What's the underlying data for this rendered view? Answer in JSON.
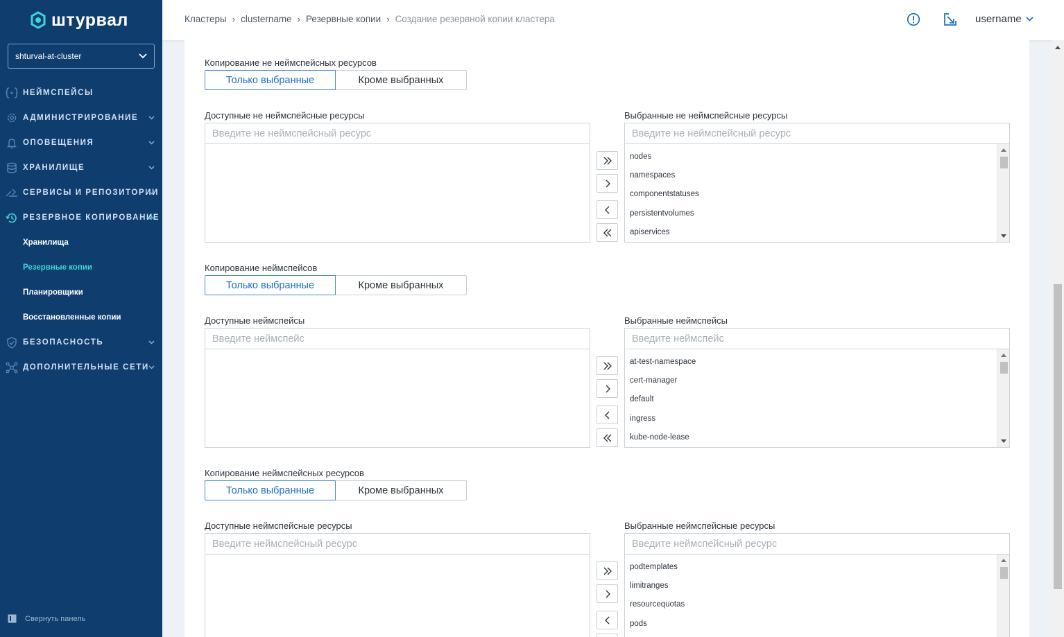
{
  "app": {
    "brand": "штурвал"
  },
  "sidebar": {
    "cluster": "shturval-at-cluster",
    "items": [
      {
        "label": "Неймспейсы",
        "icon": "braces-icon",
        "expandable": false
      },
      {
        "label": "Администрирование",
        "icon": "gear-icon",
        "expandable": true
      },
      {
        "label": "Оповещения",
        "icon": "bell-icon",
        "expandable": true
      },
      {
        "label": "Хранилище",
        "icon": "database-icon",
        "expandable": true
      },
      {
        "label": "Сервисы и репозитории",
        "icon": "services-icon",
        "expandable": true
      },
      {
        "label": "Резервное копирование",
        "icon": "backup-icon",
        "expandable": true,
        "expanded": true
      }
    ],
    "subitems": [
      {
        "label": "Хранилища",
        "active": false
      },
      {
        "label": "Резервные копии",
        "active": true
      },
      {
        "label": "Планировщики",
        "active": false
      },
      {
        "label": "Восстановленные копии",
        "active": false
      }
    ],
    "items_after": [
      {
        "label": "Безопасность",
        "icon": "shield-icon",
        "expandable": true
      },
      {
        "label": "Дополнительные сети",
        "icon": "network-icon",
        "expandable": true
      }
    ],
    "collapse_label": "Свернуть панель"
  },
  "header": {
    "breadcrumbs": [
      "Кластеры",
      "clustername",
      "Резервные копии",
      "Создание резервной копии кластера"
    ],
    "username": "username"
  },
  "colors": {
    "sidebar_bg": "#0f3d6e",
    "accent": "#1f6fc4",
    "active_sub": "#3fd4d8"
  },
  "sections": [
    {
      "title": "Копирование не неймспейсных ресурсов",
      "toggle": {
        "option_a": "Только выбранные",
        "option_b": "Кроме выбранных",
        "selected": "option_a"
      },
      "available": {
        "label": "Доступные не неймспейсные ресурсы",
        "placeholder": "Введите не неймспейсный ресурс",
        "items": []
      },
      "selected": {
        "label": "Выбранные не неймспейсные ресурсы",
        "placeholder": "Введите не неймспейсный ресурс",
        "items": [
          "nodes",
          "namespaces",
          "componentstatuses",
          "persistentvolumes",
          "apiservices"
        ]
      }
    },
    {
      "title": "Копирование неймспейсов",
      "toggle": {
        "option_a": "Только выбранные",
        "option_b": "Кроме выбранных",
        "selected": "option_a"
      },
      "available": {
        "label": "Доступные неймспейсы",
        "placeholder": "Введите неймспейс",
        "items": []
      },
      "selected": {
        "label": "Выбранные неймспейсы",
        "placeholder": "Введите неймспейс",
        "items": [
          "at-test-namespace",
          "cert-manager",
          "default",
          "ingress",
          "kube-node-lease"
        ]
      }
    },
    {
      "title": "Копирование неймспейсных ресурсов",
      "toggle": {
        "option_a": "Только выбранные",
        "option_b": "Кроме выбранных",
        "selected": "option_a"
      },
      "available": {
        "label": "Доступные неймспейсные ресурсы",
        "placeholder": "Введите неймспейсный ресурс",
        "items": []
      },
      "selected": {
        "label": "Выбранные неймспейсные ресурсы",
        "placeholder": "Введите неймспейсный ресурс",
        "items": [
          "podtemplates",
          "limitranges",
          "resourcequotas",
          "pods"
        ]
      }
    }
  ]
}
